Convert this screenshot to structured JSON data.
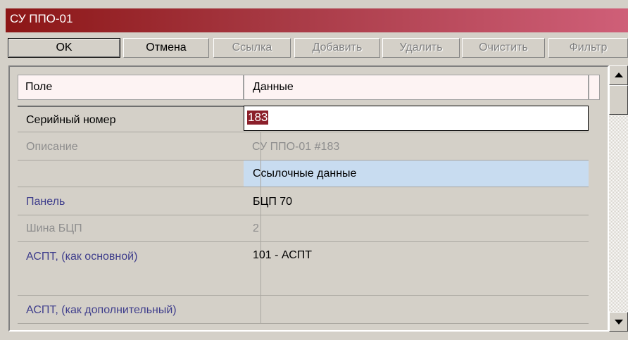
{
  "window": {
    "title": "СУ ППО-01"
  },
  "toolbar": {
    "ok": "OK",
    "cancel": "Отмена",
    "link": "Ссылка",
    "add": "Добавить",
    "delete": "Удалить",
    "clear": "Очистить",
    "filter": "Фильтр"
  },
  "grid": {
    "header": {
      "field": "Поле",
      "data": "Данные"
    },
    "rows": [
      {
        "label": "Серийный номер",
        "value": "183"
      },
      {
        "label": "Описание",
        "value": "СУ ППО-01 #183"
      },
      {
        "label": "",
        "value": "Ссылочные данные"
      },
      {
        "label": "Панель",
        "value": "БЦП 70"
      },
      {
        "label": "Шина БЦП",
        "value": "2"
      },
      {
        "label": "АСПТ, (как основной)",
        "value": "101 - АСПТ"
      },
      {
        "label": "АСПТ, (как дополнительный)",
        "value": ""
      }
    ]
  },
  "colors": {
    "title_gradient_start": "#8c1616",
    "title_gradient_end": "#cf5f78",
    "section_row_bg": "#c8dcf0",
    "selection_bg": "#8b1f2a",
    "header_bg": "#fdf3f3",
    "link_label": "#3f3e8c"
  },
  "icons": {
    "scroll_up": "arrow-up-icon",
    "scroll_down": "arrow-down-icon"
  }
}
